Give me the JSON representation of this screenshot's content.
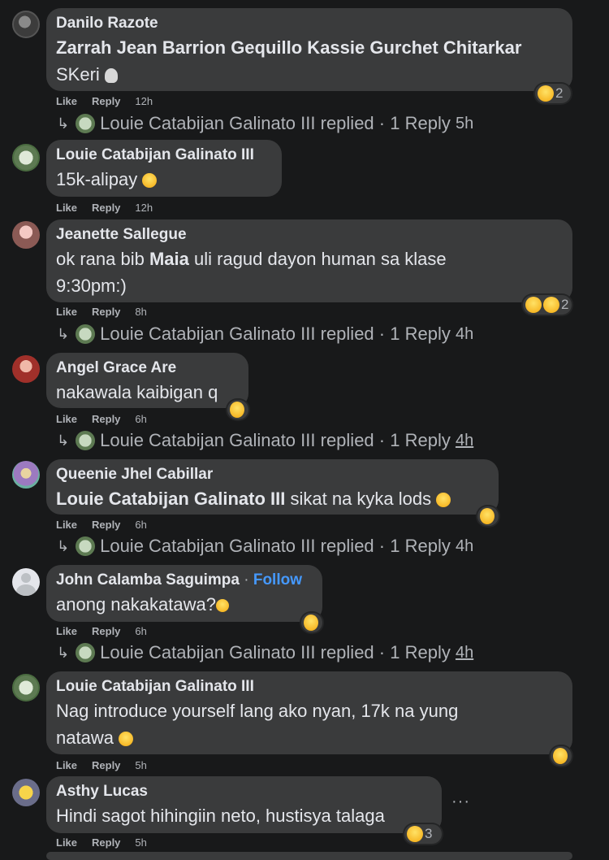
{
  "labels": {
    "like": "Like",
    "reply": "Reply",
    "replied": "replied",
    "reply_count": "1 Reply",
    "follow": "Follow",
    "sep": "·"
  },
  "comments": [
    {
      "author": "Danilo Razote",
      "mention": "Zarrah Jean Barrion Gequillo Kassie Gurchet Chitarkar",
      "text": "SKeri",
      "time": "12h",
      "reactions": "2",
      "replied_by": "Louie Catabijan Galinato III",
      "reply_time": "5h"
    },
    {
      "author": "Louie Catabijan Galinato III",
      "text": "15k-alipay",
      "time": "12h"
    },
    {
      "author": "Jeanette Sallegue",
      "text_pre": "ok rana bib ",
      "mention": "Maia",
      "text_post": " uli ragud dayon human sa klase",
      "text_line2": "9:30pm:)",
      "time": "8h",
      "reactions": "2",
      "replied_by": "Louie Catabijan Galinato III",
      "reply_time": "4h"
    },
    {
      "author": "Angel Grace Are",
      "text": "nakawala kaibigan q",
      "time": "6h",
      "replied_by": "Louie Catabijan Galinato III",
      "reply_time": "4h"
    },
    {
      "author": "Queenie Jhel Cabillar",
      "mention": "Louie Catabijan Galinato III",
      "text": " sikat na kyka lods",
      "time": "6h",
      "replied_by": "Louie Catabijan Galinato III",
      "reply_time": "4h"
    },
    {
      "author": "John Calamba Saguimpa",
      "text": "anong nakakatawa?",
      "time": "6h",
      "replied_by": "Louie Catabijan Galinato III",
      "reply_time": "4h"
    },
    {
      "author": "Louie Catabijan Galinato III",
      "text": "Nag introduce yourself lang ako nyan, 17k na yung",
      "text_line2": "natawa",
      "time": "5h"
    },
    {
      "author": "Asthy Lucas",
      "text": "Hindi sagot hihingiin neto, hustisya talaga",
      "time": "5h",
      "reactions": "3",
      "more": "···"
    }
  ],
  "colors": {
    "bg": "#18191a",
    "bubble": "#3a3b3c",
    "text": "#e4e6eb",
    "muted": "#b0b3b8",
    "link": "#4599ff"
  }
}
